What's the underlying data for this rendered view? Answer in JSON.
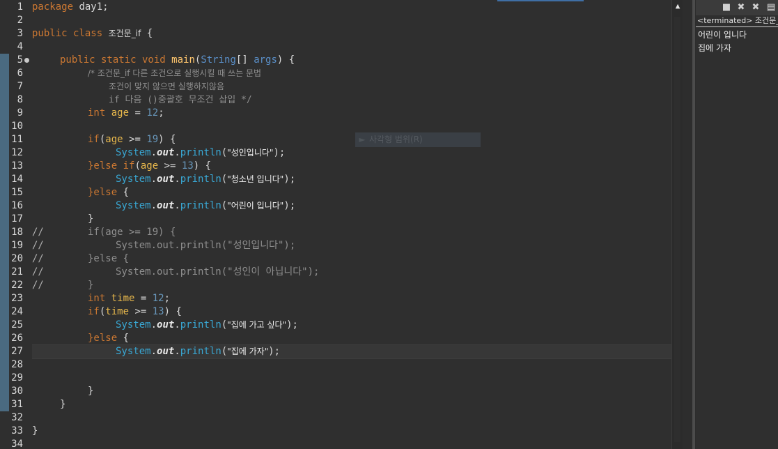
{
  "editor": {
    "line_numbers": [
      "1",
      "2",
      "3",
      "4",
      "5",
      "6",
      "7",
      "8",
      "9",
      "10",
      "11",
      "12",
      "13",
      "14",
      "15",
      "16",
      "17",
      "18",
      "19",
      "20",
      "21",
      "22",
      "23",
      "24",
      "25",
      "26",
      "27",
      "28",
      "29",
      "30",
      "31",
      "32",
      "33",
      "34"
    ],
    "lines": {
      "l1_kw": "package",
      "l1_rest": " day1;",
      "l3_kw1": "public",
      "l3_kw2": "class",
      "l3_name": "조건문_if",
      "l3_brace": "{",
      "l5_mods": "public static void",
      "l5_fn": "main",
      "l5_type": "String",
      "l5_br": "[]",
      "l5_arg": "args",
      "l5_end": ") {",
      "l6": "/* 조건문_if 다른 조건으로 실행시킬 때 쓰는 문법",
      "l7": "조건이 맞지 않으면 실행하지않음",
      "l8": "if 다음 ()중괄호 무조건 삽입 */",
      "l9_kw": "int",
      "l9_var": "age",
      "l9_eq": " = ",
      "l9_num": "12",
      "l9_end": ";",
      "l11_kw": "if",
      "l11_var": "age",
      "l11_op": " >= ",
      "l11_num": "19",
      "l11_end": ") {",
      "l12_str": "\"성인입니다\"",
      "l13_kw": "}else if",
      "l13_var": "age",
      "l13_op": " >= ",
      "l13_num": "13",
      "l13_end": ") {",
      "l14_str": "\"청소년 입니다\"",
      "l15_kw": "}else",
      "l15_end": " {",
      "l16_str": "\"어린이 입니다\"",
      "l17": "}",
      "l18": "if(age >= 19) {",
      "l19": "System.out.println(\"성인입니다\");",
      "l20": "}else {",
      "l21": "System.out.println(\"성인이 아닙니다\");",
      "l22": "}",
      "l23_kw": "int",
      "l23_var": "time",
      "l23_eq": " = ",
      "l23_num": "12",
      "l23_end": ";",
      "l24_kw": "if",
      "l24_var": "time",
      "l24_op": " >= ",
      "l24_num": "13",
      "l24_end": ") {",
      "l25_str": "\"집에 가고 싶다\"",
      "l26_kw": "}else",
      "l26_end": " {",
      "l27_str": "\"집에 가자\"",
      "l30": "}",
      "l31": "}",
      "l33": "}"
    },
    "tokens": {
      "system": "System",
      "dot": ".",
      "out": "out",
      "println": "println",
      "open": "(",
      "close": ");",
      "comment_prefix": "//"
    },
    "tooltip": "사각형 범위(R)"
  },
  "console": {
    "header": "<terminated> 조건문_if",
    "output": [
      "어린이 입니다",
      "집에 가자"
    ]
  },
  "colors": {
    "accent": "#3f6fa5",
    "background": "#2f2f2f"
  }
}
